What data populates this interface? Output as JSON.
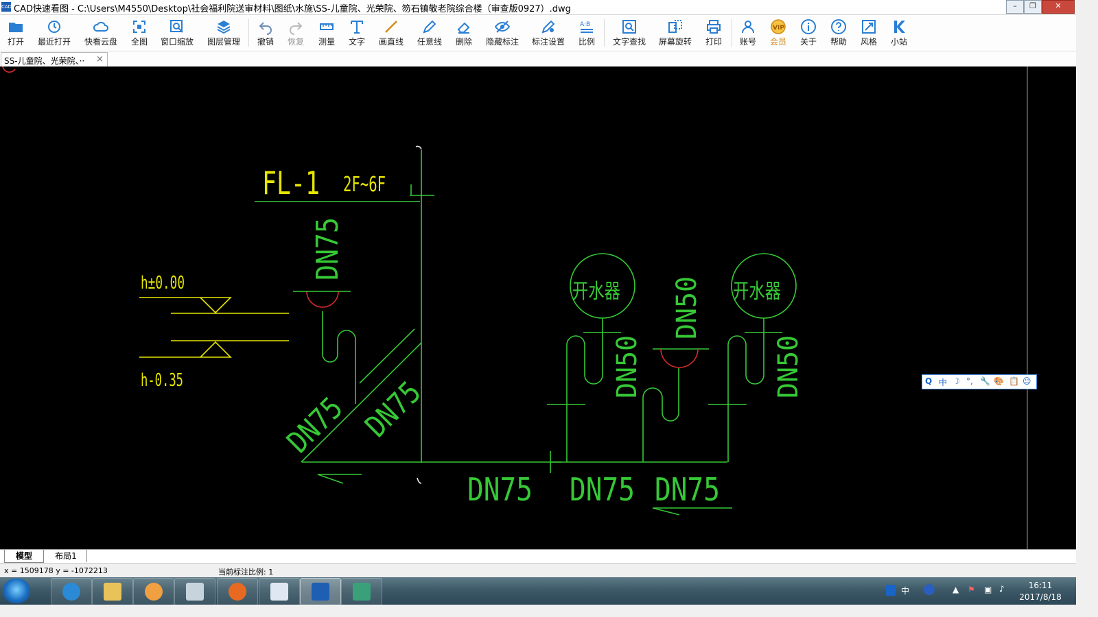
{
  "window": {
    "title": "CAD快速看图 - C:\\Users\\M4550\\Desktop\\社会福利院送审材料\\图纸\\水施\\SS-儿童院、光荣院、笏石镇敬老院综合楼（审查版0927）.dwg",
    "app_icon": "CAD"
  },
  "toolbar": {
    "open": "打开",
    "recent": "最近打开",
    "cloud": "快看云盘",
    "fullview": "全图",
    "zoom_window": "窗口缩放",
    "layers": "图层管理",
    "undo": "撤销",
    "redo": "恢复",
    "measure": "测量",
    "text": "文字",
    "line": "画直线",
    "freeline": "任意线",
    "delete": "删除",
    "hide_annot": "隐藏标注",
    "annot_settings": "标注设置",
    "scale": "比例",
    "text_search": "文字查找",
    "rotate": "屏幕旋转",
    "print": "打印",
    "account": "账号",
    "vip": "会员",
    "about": "关于",
    "help": "帮助",
    "style": "风格",
    "site": "小站"
  },
  "doc_tab": {
    "label": "SS-儿童院、光荣院、··",
    "close": "×"
  },
  "drawing": {
    "pipe_id": "FL-1",
    "floors": "2F~6F",
    "level_top": "h±0.00",
    "level_bottom": "h-0.35",
    "dn75": "DN75",
    "dn50": "DN50",
    "fixture": "开水器",
    "colors": {
      "green": "#36c836",
      "yellow": "#e6e600",
      "red": "#d22b2b",
      "white": "#e8e8e8"
    }
  },
  "ime_bar": {
    "items": [
      "Q",
      "中",
      "☽",
      "°,",
      "🔧",
      "🎨",
      "📋",
      "☺"
    ]
  },
  "layout_tabs": {
    "model": "模型",
    "layout1": "布局1"
  },
  "status": {
    "coords": "x = 1509178  y = -1072213",
    "scale_label": "当前标注比例: 1"
  },
  "tray": {
    "ime": "中",
    "time": "16:11",
    "date": "2017/8/18"
  }
}
